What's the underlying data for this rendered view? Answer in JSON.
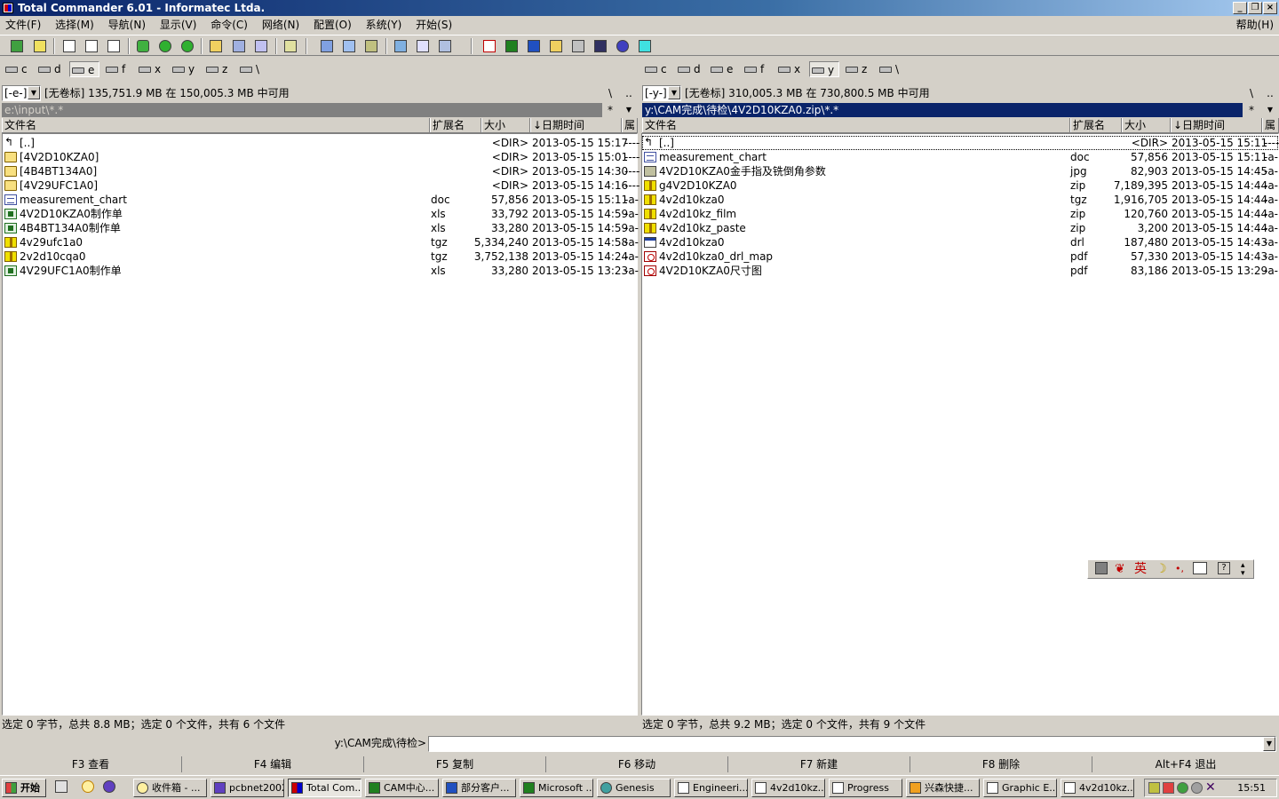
{
  "window": {
    "title": "Total Commander 6.01 - Informatec Ltda.",
    "minimize": "_",
    "restore": "❐",
    "close": "×"
  },
  "menu": {
    "items": [
      "文件(F)",
      "选择(M)",
      "导航(N)",
      "显示(V)",
      "命令(C)",
      "网络(N)",
      "配置(O)",
      "系统(Y)",
      "开始(S)"
    ],
    "help": "帮助(H)"
  },
  "left_panel": {
    "drives": [
      "c",
      "d",
      "e",
      "f",
      "x",
      "y",
      "z",
      "\\"
    ],
    "active_drive": "e",
    "drive_combo": "[-e-]",
    "free_info": "[无卷标]  135,751.9 MB 在 150,005.3 MB 中可用",
    "root_btn": "\\",
    "up_btn": "..",
    "path": "e:\\input\\*.*",
    "filter_btn": "*",
    "headers": {
      "name": "文件名",
      "ext": "扩展名",
      "size": "大小",
      "date": "↓日期时间",
      "attr": "属"
    },
    "files": [
      {
        "icon": "up",
        "name": "[..]",
        "ext": "",
        "size": "<DIR>",
        "date": "2013-05-15 15:17",
        "attr": "----"
      },
      {
        "icon": "dir",
        "name": "[4V2D10KZA0]",
        "ext": "",
        "size": "<DIR>",
        "date": "2013-05-15 15:01",
        "attr": "----"
      },
      {
        "icon": "dir",
        "name": "[4B4BT134A0]",
        "ext": "",
        "size": "<DIR>",
        "date": "2013-05-15 14:30",
        "attr": "----"
      },
      {
        "icon": "dir",
        "name": "[4V29UFC1A0]",
        "ext": "",
        "size": "<DIR>",
        "date": "2013-05-15 14:16",
        "attr": "----"
      },
      {
        "icon": "doc",
        "name": "measurement_chart",
        "ext": "doc",
        "size": "57,856",
        "date": "2013-05-15 15:11",
        "attr": "-a-"
      },
      {
        "icon": "xls",
        "name": "4V2D10KZA0制作单",
        "ext": "xls",
        "size": "33,792",
        "date": "2013-05-15 14:59",
        "attr": "-a-"
      },
      {
        "icon": "xls",
        "name": "4B4BT134A0制作单",
        "ext": "xls",
        "size": "33,280",
        "date": "2013-05-15 14:59",
        "attr": "-a-"
      },
      {
        "icon": "arc",
        "name": "4v29ufc1a0",
        "ext": "tgz",
        "size": "5,334,240",
        "date": "2013-05-15 14:58",
        "attr": "-a-"
      },
      {
        "icon": "arc",
        "name": "2v2d10cqa0",
        "ext": "tgz",
        "size": "3,752,138",
        "date": "2013-05-15 14:24",
        "attr": "-a-"
      },
      {
        "icon": "xls",
        "name": "4V29UFC1A0制作单",
        "ext": "xls",
        "size": "33,280",
        "date": "2013-05-15 13:23",
        "attr": "-a-"
      }
    ],
    "status": "选定 0 字节，总共 8.8 MB；选定 0 个文件，共有 6 个文件"
  },
  "right_panel": {
    "drives": [
      "c",
      "d",
      "e",
      "f",
      "x",
      "y",
      "z",
      "\\"
    ],
    "active_drive": "y",
    "drive_combo": "[-y-]",
    "free_info": "[无卷标]  310,005.3 MB 在 730,800.5 MB 中可用",
    "root_btn": "\\",
    "up_btn": "..",
    "path": "y:\\CAM完成\\待检\\4V2D10KZA0.zip\\*.*",
    "filter_btn": "*",
    "headers": {
      "name": "文件名",
      "ext": "扩展名",
      "size": "大小",
      "date": "↓日期时间",
      "attr": "属"
    },
    "files": [
      {
        "icon": "up",
        "name": "[..]",
        "ext": "",
        "size": "<DIR>",
        "date": "2013-05-15 15:11",
        "attr": "----"
      },
      {
        "icon": "doc",
        "name": "measurement_chart",
        "ext": "doc",
        "size": "57,856",
        "date": "2013-05-15 15:11",
        "attr": "-a-"
      },
      {
        "icon": "jpg",
        "name": "4V2D10KZA0金手指及铣倒角参数",
        "ext": "jpg",
        "size": "82,903",
        "date": "2013-05-15 14:45",
        "attr": "-a-"
      },
      {
        "icon": "arc",
        "name": "g4V2D10KZA0",
        "ext": "zip",
        "size": "7,189,395",
        "date": "2013-05-15 14:44",
        "attr": "-a-"
      },
      {
        "icon": "arc",
        "name": "4v2d10kza0",
        "ext": "tgz",
        "size": "1,916,705",
        "date": "2013-05-15 14:44",
        "attr": "-a-"
      },
      {
        "icon": "arc",
        "name": "4v2d10kz_film",
        "ext": "zip",
        "size": "120,760",
        "date": "2013-05-15 14:44",
        "attr": "-a-"
      },
      {
        "icon": "arc",
        "name": "4v2d10kz_paste",
        "ext": "zip",
        "size": "3,200",
        "date": "2013-05-15 14:44",
        "attr": "-a-"
      },
      {
        "icon": "drl",
        "name": "4v2d10kza0",
        "ext": "drl",
        "size": "187,480",
        "date": "2013-05-15 14:43",
        "attr": "-a-"
      },
      {
        "icon": "pdf",
        "name": "4v2d10kza0_drl_map",
        "ext": "pdf",
        "size": "57,330",
        "date": "2013-05-15 14:43",
        "attr": "-a-"
      },
      {
        "icon": "pdf",
        "name": "4V2D10KZA0尺寸图",
        "ext": "pdf",
        "size": "83,186",
        "date": "2013-05-15 13:29",
        "attr": "-a-"
      }
    ],
    "status": "选定 0 字节，总共 9.2 MB；选定 0 个文件，共有 9 个文件"
  },
  "command": {
    "label": "y:\\CAM完成\\待检>",
    "value": ""
  },
  "fkeys": [
    "F3 查看",
    "F4 编辑",
    "F5 复制",
    "F6 移动",
    "F7 新建",
    "F8 删除",
    "Alt+F4 退出"
  ],
  "ime": {
    "lang": "英",
    "moon": "☽",
    "dot": "•,",
    "help": "?"
  },
  "taskbar": {
    "start": "开始",
    "buttons": [
      "收件箱 - ...",
      "pcbnet2002",
      "Total Com...",
      "CAM中心...",
      "部分客户...",
      "Microsoft ...",
      "Genesis",
      "Engineeri...",
      "4v2d10kz...",
      "Progress",
      "兴森快捷...",
      "Graphic E...",
      "4v2d10kz..."
    ],
    "active_button": "Total Com...",
    "clock": "15:51"
  }
}
